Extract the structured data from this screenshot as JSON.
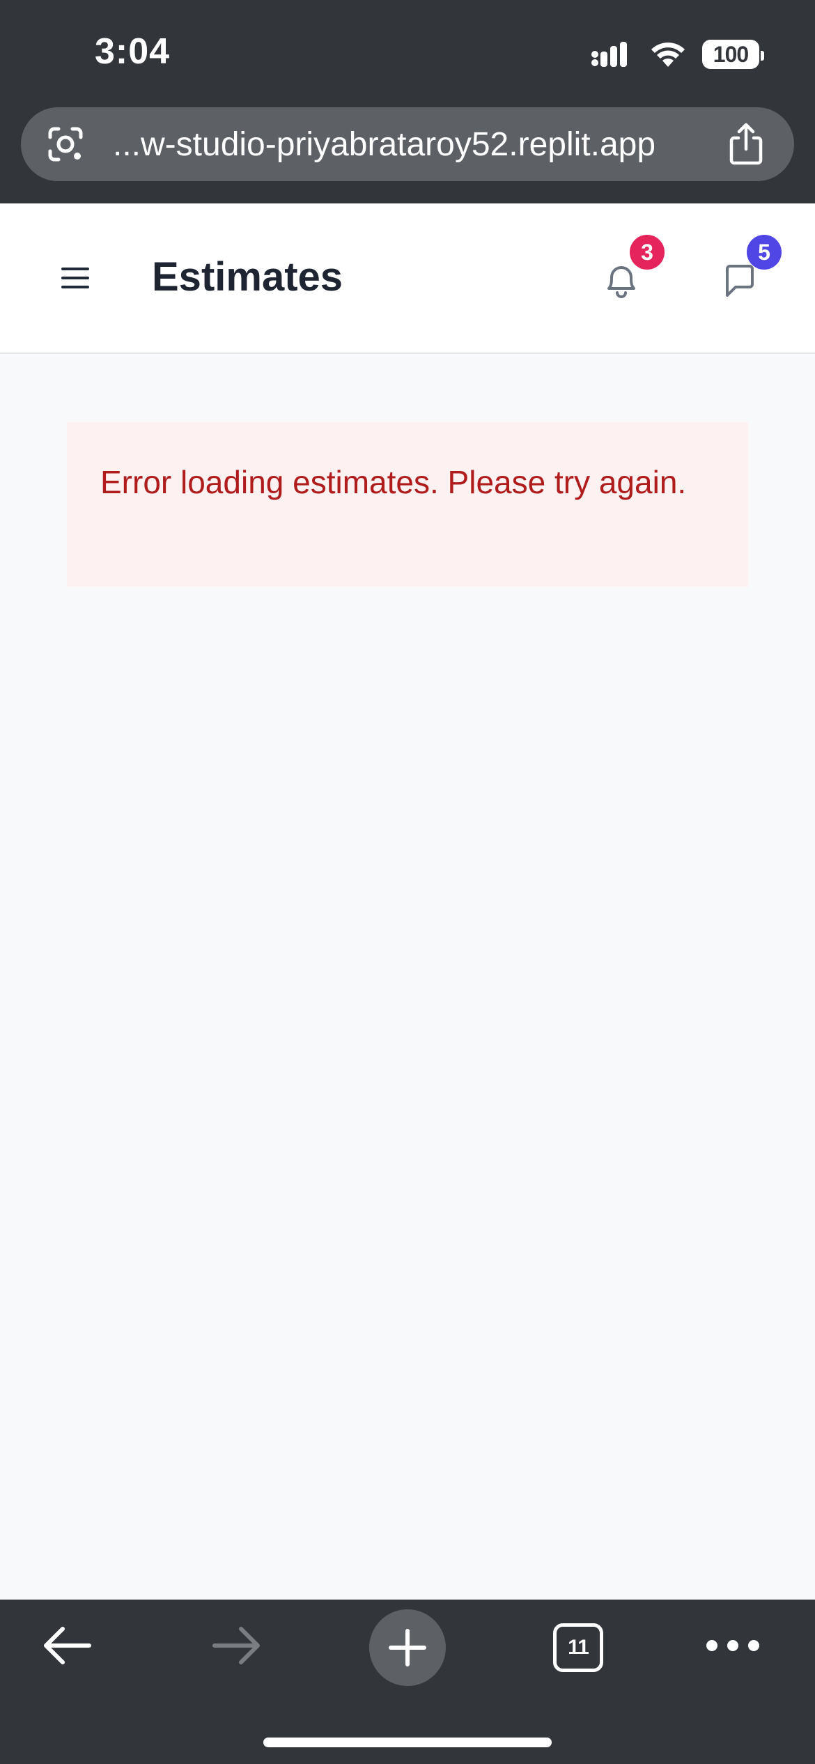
{
  "status_bar": {
    "time": "3:04",
    "battery": "100"
  },
  "browser": {
    "url": "...w-studio-priyabrataroy52.replit.app",
    "tab_count": "11"
  },
  "header": {
    "title": "Estimates",
    "notifications_count": "3",
    "messages_count": "5",
    "colors": {
      "notifications_badge": "#e6245c",
      "messages_badge": "#4f46e5"
    }
  },
  "main": {
    "error_message": "Error loading estimates. Please try again.",
    "colors": {
      "error_text": "#b01c1c",
      "error_background": "#fdf1f1"
    }
  },
  "icons": {
    "menu": "menu-icon",
    "notifications": "bell-icon",
    "messages": "chat-icon",
    "lens": "lens-icon",
    "share": "share-icon",
    "back": "arrow-left-icon",
    "forward": "arrow-right-icon",
    "new_tab": "plus-icon",
    "more": "more-icon"
  }
}
